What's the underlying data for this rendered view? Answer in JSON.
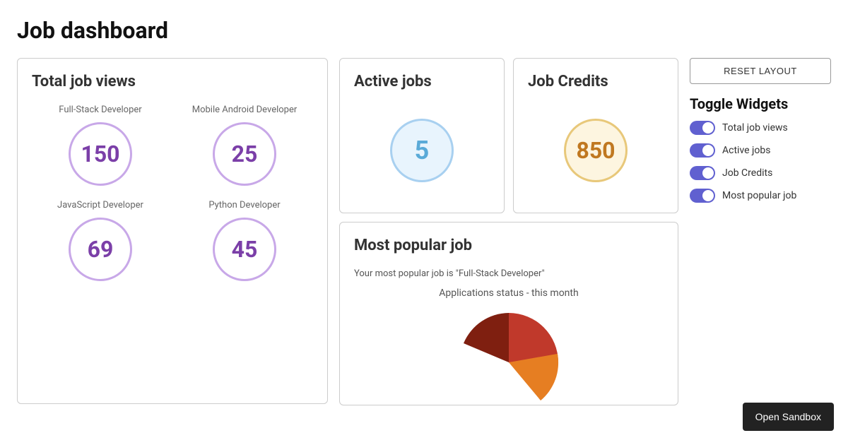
{
  "page": {
    "title": "Job dashboard"
  },
  "reset_button": {
    "label": "RESET LAYOUT"
  },
  "open_sandbox": {
    "label": "Open Sandbox"
  },
  "total_job_views": {
    "title": "Total job views",
    "jobs": [
      {
        "label": "Full-Stack Developer",
        "value": "150"
      },
      {
        "label": "Mobile Android Developer",
        "value": "25"
      },
      {
        "label": "JavaScript Developer",
        "value": "69"
      },
      {
        "label": "Python Developer",
        "value": "45"
      }
    ]
  },
  "active_jobs": {
    "title": "Active jobs",
    "value": "5"
  },
  "job_credits": {
    "title": "Job Credits",
    "value": "850"
  },
  "most_popular_job": {
    "title": "Most popular job",
    "description": "Your most popular job is \"Full-Stack Developer\"",
    "chart_label": "Applications status - this month"
  },
  "toggle_widgets": {
    "title": "Toggle Widgets",
    "items": [
      {
        "label": "Total job views",
        "enabled": true
      },
      {
        "label": "Active jobs",
        "enabled": true
      },
      {
        "label": "Job Credits",
        "enabled": true
      },
      {
        "label": "Most popular job",
        "enabled": true
      }
    ]
  }
}
